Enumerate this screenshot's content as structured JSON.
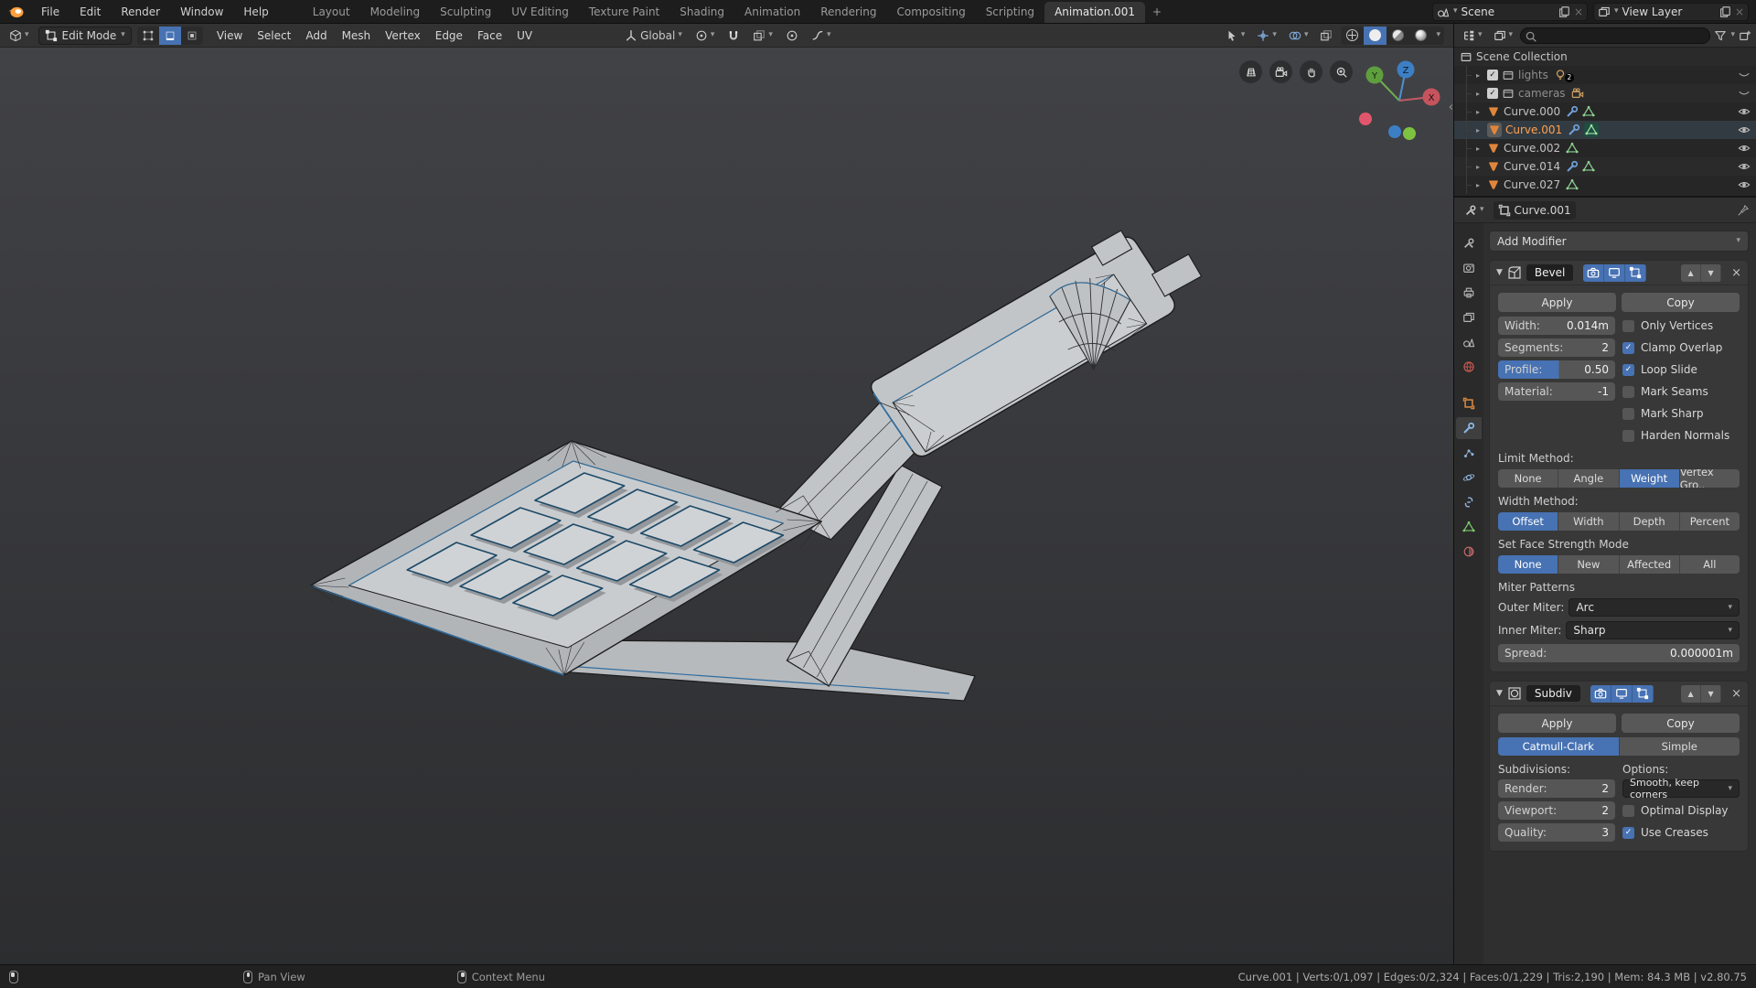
{
  "topbar": {
    "menus": [
      "File",
      "Edit",
      "Render",
      "Window",
      "Help"
    ],
    "workspaces": [
      "Layout",
      "Modeling",
      "Sculpting",
      "UV Editing",
      "Texture Paint",
      "Shading",
      "Animation",
      "Rendering",
      "Compositing",
      "Scripting",
      "Animation.001"
    ],
    "active_workspace": "Animation.001",
    "add_workspace": "+",
    "scene": {
      "label": "Scene"
    },
    "view_layer": {
      "label": "View Layer"
    }
  },
  "viewport_header": {
    "mode": "Edit Mode",
    "menus": [
      "View",
      "Select",
      "Add",
      "Mesh",
      "Vertex",
      "Edge",
      "Face",
      "UV"
    ],
    "orientation": "Global"
  },
  "viewport": {
    "gizmo": {
      "x": "X",
      "y": "Y",
      "z": "Z"
    }
  },
  "outliner": {
    "search_placeholder": "",
    "rows": [
      {
        "label": "Scene Collection"
      },
      {
        "label": "lights",
        "badge": "2"
      },
      {
        "label": "cameras"
      },
      {
        "label": "Curve.000"
      },
      {
        "label": "Curve.001"
      },
      {
        "label": "Curve.002"
      },
      {
        "label": "Curve.014"
      },
      {
        "label": "Curve.027"
      }
    ]
  },
  "properties": {
    "breadcrumb": "Curve.001",
    "add_modifier": "Add Modifier",
    "bevel": {
      "name": "Bevel",
      "apply": "Apply",
      "copy": "Copy",
      "width_label": "Width:",
      "width_value": "0.014m",
      "segments_label": "Segments:",
      "segments_value": "2",
      "profile_label": "Profile:",
      "profile_value": "0.50",
      "material_label": "Material:",
      "material_value": "-1",
      "checks": [
        {
          "label": "Only Vertices",
          "checked": false
        },
        {
          "label": "Clamp Overlap",
          "checked": true
        },
        {
          "label": "Loop Slide",
          "checked": true
        },
        {
          "label": "Mark Seams",
          "checked": false
        },
        {
          "label": "Mark Sharp",
          "checked": false
        },
        {
          "label": "Harden Normals",
          "checked": false
        }
      ],
      "limit_label": "Limit Method:",
      "limit_options": [
        "None",
        "Angle",
        "Weight",
        "Vertex Gro.."
      ],
      "limit_active": "Weight",
      "widthm_label": "Width Method:",
      "widthm_options": [
        "Offset",
        "Width",
        "Depth",
        "Percent"
      ],
      "widthm_active": "Offset",
      "fsm_label": "Set Face Strength Mode",
      "fsm_options": [
        "None",
        "New",
        "Affected",
        "All"
      ],
      "fsm_active": "None",
      "miter_label": "Miter Patterns",
      "outer_label": "Outer Miter:",
      "outer_value": "Arc",
      "inner_label": "Inner Miter:",
      "inner_value": "Sharp",
      "spread_label": "Spread:",
      "spread_value": "0.000001m"
    },
    "subdiv": {
      "name": "Subdiv",
      "apply": "Apply",
      "copy": "Copy",
      "algo_options": [
        "Catmull-Clark",
        "Simple"
      ],
      "algo_active": "Catmull-Clark",
      "subdivisions_label": "Subdivisions:",
      "options_label": "Options:",
      "render_label": "Render:",
      "render_value": "2",
      "viewport_label": "Viewport:",
      "viewport_value": "2",
      "quality_label": "Quality:",
      "quality_value": "3",
      "uv_smooth": "Smooth, keep corners",
      "optimal": {
        "label": "Optimal Display",
        "checked": false
      },
      "creases": {
        "label": "Use Creases",
        "checked": true
      }
    }
  },
  "statusbar": {
    "hint_pan": "Pan View",
    "hint_context": "Context Menu",
    "info": "Curve.001 | Verts:0/1,097 | Edges:0/2,324 | Faces:0/1,229 | Tris:2,190 | Mem: 84.3 MB | v2.80.75"
  },
  "icons": {
    "chevron": "▾",
    "panel_open": "▼",
    "up": "▲",
    "down": "▼",
    "close": "×",
    "row_collapsed": "▸",
    "collapse_region": "‹",
    "check": "✓"
  }
}
